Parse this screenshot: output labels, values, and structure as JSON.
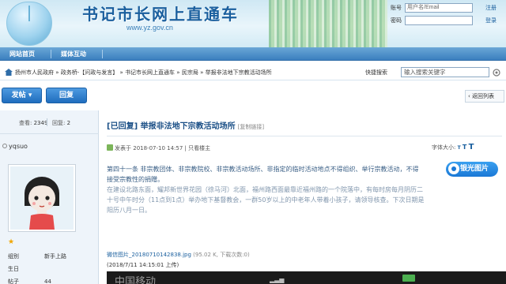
{
  "header": {
    "title": "书记市长网上直通车",
    "url": "www.yz.gov.cn",
    "login": {
      "account_label": "账号",
      "account_placeholder": "用户名/Email",
      "password_label": "密码",
      "register": "注册",
      "login": "登录"
    }
  },
  "nav": {
    "items": [
      "网站首页",
      "媒体互动"
    ]
  },
  "breadcrumb": {
    "items": [
      "扬州市人民政府",
      "政务桥-【问政与发言】",
      "书记市长网上直通车",
      "民宗局",
      "举报非法地下宗教活动场所"
    ],
    "separator": "»",
    "quick_search_label": "快捷搜索",
    "search_placeholder": "输入搜索关键字"
  },
  "actions": {
    "post": "发帖",
    "reply": "回复",
    "back_to_list": "返回列表"
  },
  "author": {
    "views_label": "查看:",
    "views": "2349",
    "replies_label": "回复:",
    "replies": "2",
    "username": "yqsuo",
    "fields": [
      {
        "key": "组别",
        "value": "新手上路"
      },
      {
        "key": "生日",
        "value": ""
      },
      {
        "key": "帖子",
        "value": "44"
      }
    ]
  },
  "post": {
    "title": "[已回复] 举报非法地下宗教活动场所",
    "copy_link": "[复制链接]",
    "posted_prefix": "发表于",
    "posted_at": "2018-07-10 14:57",
    "only_author": "只看楼主",
    "font_size_label": "字体大小:",
    "font_t": "T",
    "paragraph1": "第四十一条 非宗教团体、非宗教院校、非宗教活动场所、非指定的临时活动地点不得组织、举行宗教活动，不得接受宗教性的捐赠。",
    "paragraph2": "在建设北路东面，耀邦新世界花园（徐马河）北面，福州路西面最靠近福州路的一个院落中，有每时房每月阴历二十号中午时分（11点到1点）举办地下基督教会，一群50岁以上的中老年人带着小孩子，请领导核查。下次日期是阳历八月一日。",
    "attachment_name": "微信图片_20180710142838.jpg",
    "attachment_size": "(95.02 K, 下载次数:0)",
    "attachment_date": "(2018/7/11 14:15:01 上传)",
    "badge": "银光图片",
    "phone_status": "中国移动"
  },
  "colors": {
    "brand_blue": "#1a5f9e",
    "nav_blue": "#3b7fbf",
    "link_blue": "#3a5f86"
  }
}
